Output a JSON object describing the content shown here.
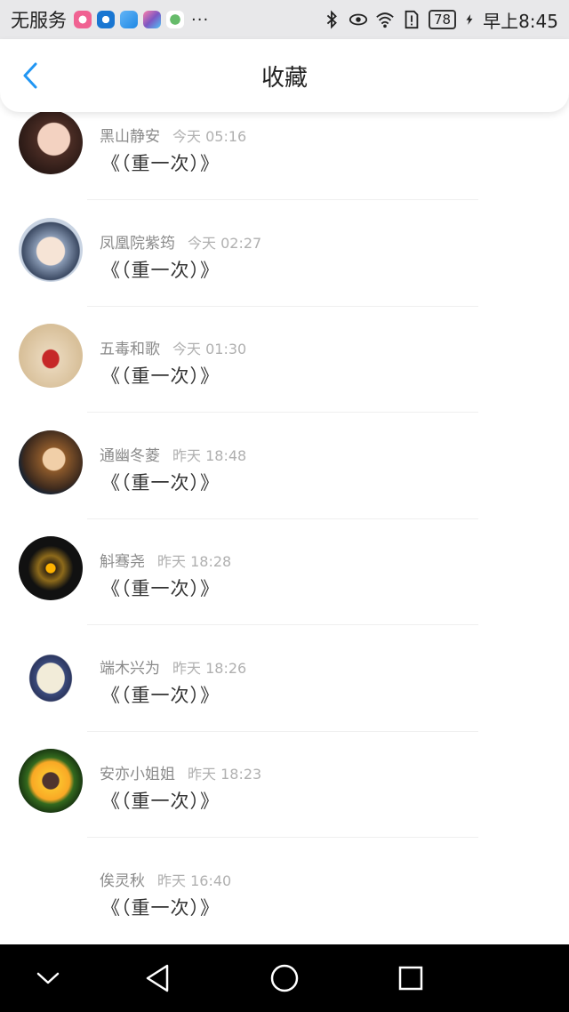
{
  "status_bar": {
    "carrier": "无服务",
    "more": "···",
    "battery": "78",
    "time": "早上8:45"
  },
  "header": {
    "title": "收藏"
  },
  "favorites": [
    {
      "name": "黑山静安",
      "time": "今天 05:16",
      "message": "《（重一次）》"
    },
    {
      "name": "凤凰院紫筠",
      "time": "今天 02:27",
      "message": "《（重一次）》"
    },
    {
      "name": "五毒和歌",
      "time": "今天 01:30",
      "message": "《（重一次）》"
    },
    {
      "name": "通幽冬菱",
      "time": "昨天 18:48",
      "message": "《（重一次）》"
    },
    {
      "name": "斛骞尧",
      "time": "昨天 18:28",
      "message": "《（重一次）》"
    },
    {
      "name": "端木兴为",
      "time": "昨天 18:26",
      "message": "《（重一次）》"
    },
    {
      "name": "安亦小姐姐",
      "time": "昨天 18:23",
      "message": "《（重一次）》"
    },
    {
      "name": "俟灵秋",
      "time": "昨天 16:40",
      "message": "《（重一次）》"
    }
  ],
  "icons": {
    "back": "chevron-left-icon",
    "nav_down": "chevron-down-icon",
    "nav_back": "triangle-back-icon",
    "nav_home": "circle-home-icon",
    "nav_recent": "square-recent-icon"
  },
  "colors": {
    "accent": "#2196f3",
    "status_bar_bg": "#e8e8ea",
    "nav_bar_bg": "#000000"
  }
}
